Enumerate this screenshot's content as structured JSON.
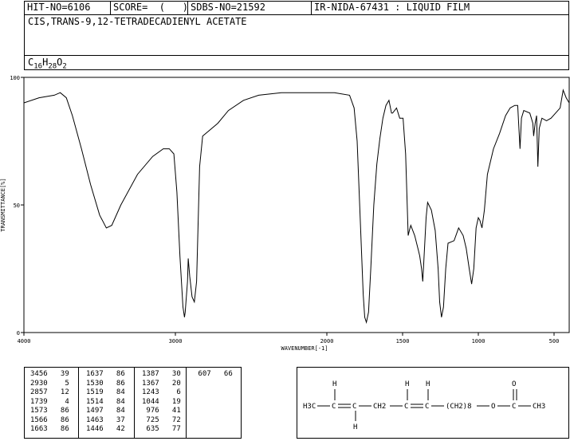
{
  "header": {
    "hit_no": "HIT-NO=6106",
    "score": "SCORE=  (   )",
    "sdbs_no": "SDBS-NO=21592",
    "ir": "IR-NIDA-67431 : LIQUID FILM"
  },
  "compound": {
    "name": "CIS,TRANS-9,12-TETRADECADIENYL ACETATE",
    "formula_parts": [
      {
        "t": "C",
        "sub": false
      },
      {
        "t": "16",
        "sub": true
      },
      {
        "t": "H",
        "sub": false
      },
      {
        "t": "28",
        "sub": true
      },
      {
        "t": "O",
        "sub": false
      },
      {
        "t": "2",
        "sub": true
      }
    ]
  },
  "chart_data": {
    "type": "line",
    "title": "",
    "xlabel": "WAVENUMBER[-1]",
    "ylabel": "TRANSMITTANCE[%]",
    "xlim": [
      4000,
      400
    ],
    "ylim": [
      0,
      100
    ],
    "xticks": [
      4000,
      3000,
      2000,
      1500,
      1000,
      500
    ],
    "yticks": [
      0,
      50,
      100
    ],
    "series": [
      {
        "points": [
          [
            4000,
            90
          ],
          [
            3900,
            92
          ],
          [
            3800,
            93
          ],
          [
            3760,
            94
          ],
          [
            3720,
            92
          ],
          [
            3680,
            85
          ],
          [
            3620,
            72
          ],
          [
            3560,
            58
          ],
          [
            3500,
            46
          ],
          [
            3456,
            41
          ],
          [
            3420,
            42
          ],
          [
            3360,
            50
          ],
          [
            3250,
            62
          ],
          [
            3150,
            69
          ],
          [
            3080,
            72
          ],
          [
            3040,
            72
          ],
          [
            3010,
            70
          ],
          [
            2990,
            55
          ],
          [
            2970,
            30
          ],
          [
            2950,
            10
          ],
          [
            2940,
            6
          ],
          [
            2935,
            8
          ],
          [
            2920,
            20
          ],
          [
            2915,
            29
          ],
          [
            2905,
            22
          ],
          [
            2890,
            14
          ],
          [
            2875,
            12
          ],
          [
            2860,
            20
          ],
          [
            2840,
            65
          ],
          [
            2820,
            77
          ],
          [
            2780,
            79
          ],
          [
            2720,
            82
          ],
          [
            2650,
            87
          ],
          [
            2550,
            91
          ],
          [
            2450,
            93
          ],
          [
            2300,
            94
          ],
          [
            2100,
            94
          ],
          [
            1950,
            94
          ],
          [
            1850,
            93
          ],
          [
            1820,
            88
          ],
          [
            1800,
            75
          ],
          [
            1780,
            45
          ],
          [
            1760,
            15
          ],
          [
            1750,
            6
          ],
          [
            1739,
            4
          ],
          [
            1725,
            8
          ],
          [
            1710,
            25
          ],
          [
            1690,
            50
          ],
          [
            1670,
            66
          ],
          [
            1650,
            76
          ],
          [
            1630,
            84
          ],
          [
            1610,
            89
          ],
          [
            1590,
            91
          ],
          [
            1573,
            86
          ],
          [
            1566,
            86
          ],
          [
            1540,
            88
          ],
          [
            1519,
            84
          ],
          [
            1514,
            84
          ],
          [
            1497,
            84
          ],
          [
            1480,
            70
          ],
          [
            1463,
            38
          ],
          [
            1455,
            40
          ],
          [
            1446,
            42
          ],
          [
            1420,
            38
          ],
          [
            1395,
            32
          ],
          [
            1387,
            30
          ],
          [
            1375,
            25
          ],
          [
            1367,
            20
          ],
          [
            1355,
            33
          ],
          [
            1345,
            45
          ],
          [
            1335,
            51
          ],
          [
            1310,
            48
          ],
          [
            1285,
            40
          ],
          [
            1265,
            25
          ],
          [
            1255,
            12
          ],
          [
            1243,
            6
          ],
          [
            1230,
            10
          ],
          [
            1215,
            25
          ],
          [
            1200,
            35
          ],
          [
            1160,
            36
          ],
          [
            1130,
            41
          ],
          [
            1100,
            38
          ],
          [
            1080,
            33
          ],
          [
            1060,
            25
          ],
          [
            1044,
            19
          ],
          [
            1030,
            25
          ],
          [
            1015,
            41
          ],
          [
            1000,
            45
          ],
          [
            990,
            44
          ],
          [
            976,
            41
          ],
          [
            960,
            48
          ],
          [
            940,
            62
          ],
          [
            900,
            72
          ],
          [
            860,
            78
          ],
          [
            820,
            85
          ],
          [
            790,
            88
          ],
          [
            760,
            89
          ],
          [
            740,
            89
          ],
          [
            735,
            83
          ],
          [
            725,
            72
          ],
          [
            715,
            84
          ],
          [
            700,
            87
          ],
          [
            660,
            86
          ],
          [
            640,
            82
          ],
          [
            635,
            77
          ],
          [
            625,
            82
          ],
          [
            615,
            85
          ],
          [
            607,
            65
          ],
          [
            598,
            80
          ],
          [
            580,
            84
          ],
          [
            550,
            83
          ],
          [
            520,
            84
          ],
          [
            490,
            86
          ],
          [
            460,
            88
          ],
          [
            440,
            95
          ],
          [
            420,
            92
          ],
          [
            400,
            90
          ]
        ]
      }
    ]
  },
  "peaks": [
    [
      [
        3456,
        39
      ],
      [
        2930,
        5
      ],
      [
        2857,
        12
      ],
      [
        1739,
        4
      ],
      [
        1573,
        86
      ],
      [
        1566,
        86
      ],
      [
        1663,
        86
      ]
    ],
    [
      [
        1637,
        86
      ],
      [
        1530,
        86
      ],
      [
        1519,
        84
      ],
      [
        1514,
        84
      ],
      [
        1497,
        84
      ],
      [
        1463,
        37
      ],
      [
        1446,
        42
      ]
    ],
    [
      [
        1387,
        30
      ],
      [
        1367,
        20
      ],
      [
        1243,
        6
      ],
      [
        1044,
        19
      ],
      [
        976,
        41
      ],
      [
        725,
        72
      ],
      [
        635,
        77
      ]
    ],
    [
      [
        607,
        66
      ]
    ]
  ],
  "structure": {
    "ch3": "H3C",
    "ch2": "CH2",
    "ch2n": "(CH2)8",
    "h": "H",
    "o": "O",
    "c": "C",
    "ch3_end": "CH3"
  }
}
